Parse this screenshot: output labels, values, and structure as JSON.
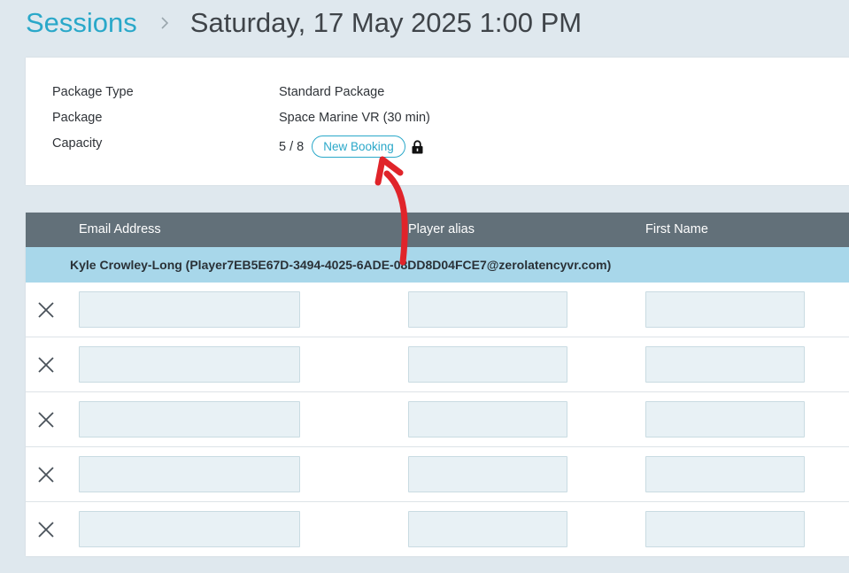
{
  "breadcrumb": {
    "parent": "Sessions",
    "current": "Saturday, 17 May 2025 1:00 PM"
  },
  "session_info": {
    "package_type_label": "Package Type",
    "package_type_value": "Standard Package",
    "package_label": "Package",
    "package_value": "Space Marine VR (30 min)",
    "capacity_label": "Capacity",
    "capacity_value": "5 / 8",
    "new_booking_label": "New Booking",
    "lock_icon": "lock-icon"
  },
  "table": {
    "columns": [
      "Email Address",
      "Player alias",
      "First Name"
    ],
    "group_header": "Kyle Crowley-Long (Player7EB5E67D-3494-4025-6ADE-08DD8D04FCE7@zerolatencyvr.com)",
    "rows": [
      {
        "email": "",
        "alias": "",
        "first_name": ""
      },
      {
        "email": "",
        "alias": "",
        "first_name": ""
      },
      {
        "email": "",
        "alias": "",
        "first_name": ""
      },
      {
        "email": "",
        "alias": "",
        "first_name": ""
      },
      {
        "email": "",
        "alias": "",
        "first_name": ""
      }
    ],
    "remove_icon": "close-icon"
  },
  "colors": {
    "accent": "#2aa8c9",
    "header_bg": "#627079",
    "group_bg": "#a8d7ea",
    "annotation_arrow": "#e0242a"
  }
}
